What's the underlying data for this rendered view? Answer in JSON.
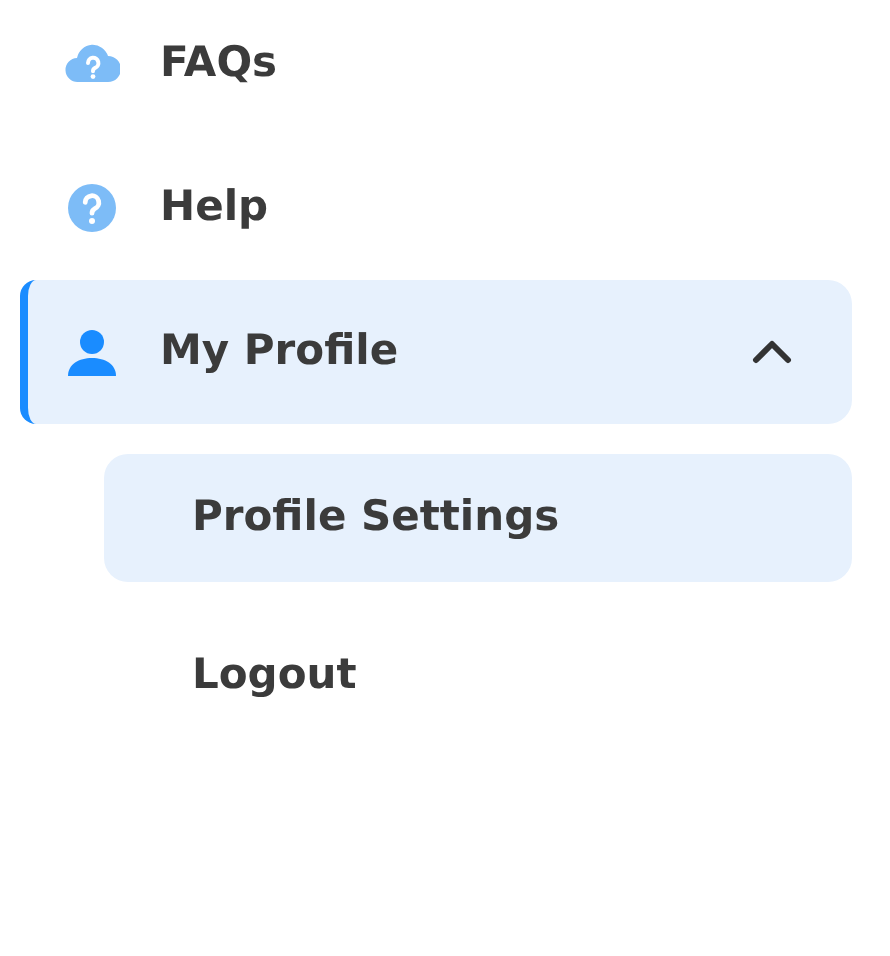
{
  "menu": [
    {
      "label": "FAQs",
      "selected": false
    },
    {
      "label": "Help",
      "selected": false
    },
    {
      "label": "My Profile",
      "selected": true,
      "expanded": true,
      "children": [
        {
          "label": "Profile Settings",
          "selected": true
        },
        {
          "label": "Logout",
          "selected": false
        }
      ]
    }
  ]
}
